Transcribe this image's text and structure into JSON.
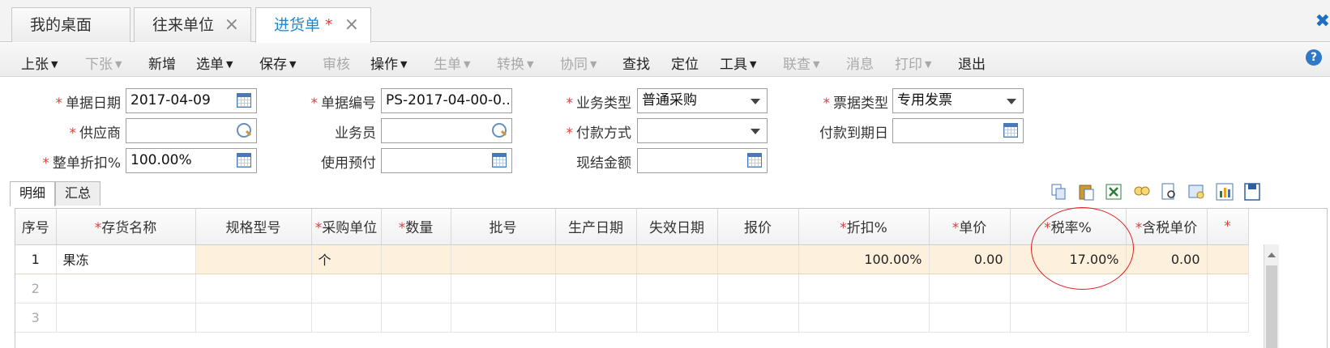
{
  "tabs": [
    {
      "label": "我的桌面"
    },
    {
      "label": "往来单位",
      "close": "×"
    },
    {
      "label": "进货单",
      "star": "*",
      "close": "×"
    }
  ],
  "edge_close": "✖",
  "toolbar": {
    "items": [
      {
        "label": "上张",
        "enabled": true,
        "dropdown": true
      },
      {
        "label": "下张",
        "enabled": false,
        "dropdown": true
      },
      {
        "label": "新增",
        "enabled": true
      },
      {
        "label": "选单",
        "enabled": true,
        "dropdown": true
      },
      {
        "label": "保存",
        "enabled": true,
        "dropdown": true
      },
      {
        "label": "审核",
        "enabled": false
      },
      {
        "label": "操作",
        "enabled": true,
        "dropdown": true
      },
      {
        "label": "生单",
        "enabled": false,
        "dropdown": true
      },
      {
        "label": "转换",
        "enabled": false,
        "dropdown": true
      },
      {
        "label": "协同",
        "enabled": false,
        "dropdown": true
      },
      {
        "label": "查找",
        "enabled": true
      },
      {
        "label": "定位",
        "enabled": true
      },
      {
        "label": "工具",
        "enabled": true,
        "dropdown": true
      },
      {
        "label": "联查",
        "enabled": false,
        "dropdown": true
      },
      {
        "label": "消息",
        "enabled": false
      },
      {
        "label": "打印",
        "enabled": false,
        "dropdown": true
      },
      {
        "label": "退出",
        "enabled": true
      }
    ],
    "help": "?"
  },
  "form": {
    "required_mark": "*",
    "doc_date": {
      "label": "单据日期",
      "value": "2017-04-09"
    },
    "doc_no": {
      "label": "单据编号",
      "value": "PS-2017-04-00-0..."
    },
    "biz_type": {
      "label": "业务类型",
      "value": "普通采购"
    },
    "invoice_type": {
      "label": "票据类型",
      "value": "专用发票"
    },
    "supplier": {
      "label": "供应商",
      "value": ""
    },
    "salesman": {
      "label": "业务员",
      "value": ""
    },
    "payment_method": {
      "label": "付款方式",
      "value": ""
    },
    "due_date": {
      "label": "付款到期日",
      "value": ""
    },
    "discount": {
      "label": "整单折扣%",
      "value": "100.00%"
    },
    "use_prepay": {
      "label": "使用预付",
      "value": ""
    },
    "cash_amount": {
      "label": "现结金额",
      "value": ""
    }
  },
  "subtabs": [
    {
      "label": "明细"
    },
    {
      "label": "汇总"
    }
  ],
  "grid": {
    "columns": [
      {
        "label": "序号",
        "req": false
      },
      {
        "label": "存货名称",
        "req": true
      },
      {
        "label": "规格型号",
        "req": false
      },
      {
        "label": "采购单位",
        "req": true
      },
      {
        "label": "数量",
        "req": true
      },
      {
        "label": "批号",
        "req": false
      },
      {
        "label": "生产日期",
        "req": false
      },
      {
        "label": "失效日期",
        "req": false
      },
      {
        "label": "报价",
        "req": false
      },
      {
        "label": "折扣%",
        "req": true
      },
      {
        "label": "单价",
        "req": true
      },
      {
        "label": "税率%",
        "req": true
      },
      {
        "label": "含税单价",
        "req": true
      },
      {
        "label": "",
        "req": true
      }
    ],
    "rows": [
      [
        "1",
        "果冻",
        "",
        "个",
        "",
        "",
        "",
        "",
        "",
        "100.00%",
        "0.00",
        "17.00%",
        "0.00",
        ""
      ],
      [
        "2",
        "",
        "",
        "",
        "",
        "",
        "",
        "",
        "",
        "",
        "",
        "",
        "",
        ""
      ],
      [
        "3",
        "",
        "",
        "",
        "",
        "",
        "",
        "",
        "",
        "",
        "",
        "",
        "",
        ""
      ]
    ]
  },
  "colors": {
    "accent": "#1a8ad4",
    "required": "#e23b3b",
    "row_highlight": "#fdf0dc",
    "annotation": "#dd2222"
  }
}
